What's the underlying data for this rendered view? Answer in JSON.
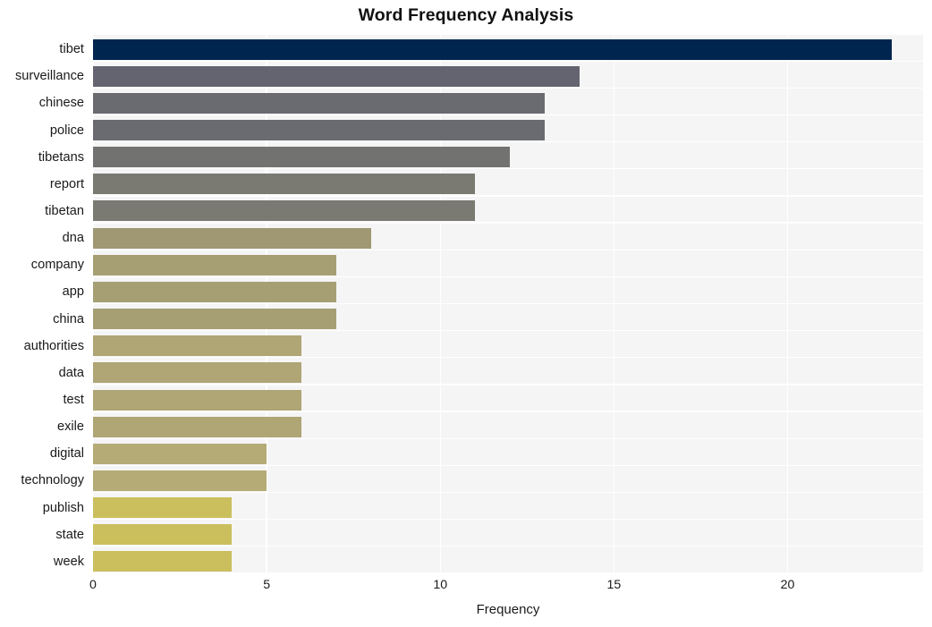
{
  "chart_data": {
    "type": "bar",
    "orientation": "horizontal",
    "title": "Word Frequency Analysis",
    "xlabel": "Frequency",
    "ylabel": "",
    "categories": [
      "tibet",
      "surveillance",
      "chinese",
      "police",
      "tibetans",
      "report",
      "tibetan",
      "dna",
      "company",
      "app",
      "china",
      "authorities",
      "data",
      "test",
      "exile",
      "digital",
      "technology",
      "publish",
      "state",
      "week"
    ],
    "values": [
      23,
      14,
      13,
      13,
      12,
      11,
      11,
      8,
      7,
      7,
      7,
      6,
      6,
      6,
      6,
      5,
      5,
      4,
      4,
      4
    ],
    "bar_colors": [
      "#00254f",
      "#636470",
      "#6a6a71",
      "#6a6a71",
      "#727270",
      "#7a7a73",
      "#7a7a73",
      "#9f9872",
      "#a79f74",
      "#a79f74",
      "#a79f74",
      "#afa575",
      "#afa575",
      "#afa575",
      "#afa575",
      "#b5ab76",
      "#b5ab76",
      "#cbbf5d",
      "#cbbf5d",
      "#cbbf5d"
    ],
    "xlim": [
      0,
      23.9
    ],
    "xticks": [
      0,
      5,
      10,
      15,
      20
    ],
    "xtick_labels": [
      "0",
      "5",
      "10",
      "15",
      "20"
    ],
    "grid": true,
    "grid_color": "#ffffff",
    "plot_background": "#f5f5f6",
    "figure_background": "#ffffff",
    "legend": null
  }
}
